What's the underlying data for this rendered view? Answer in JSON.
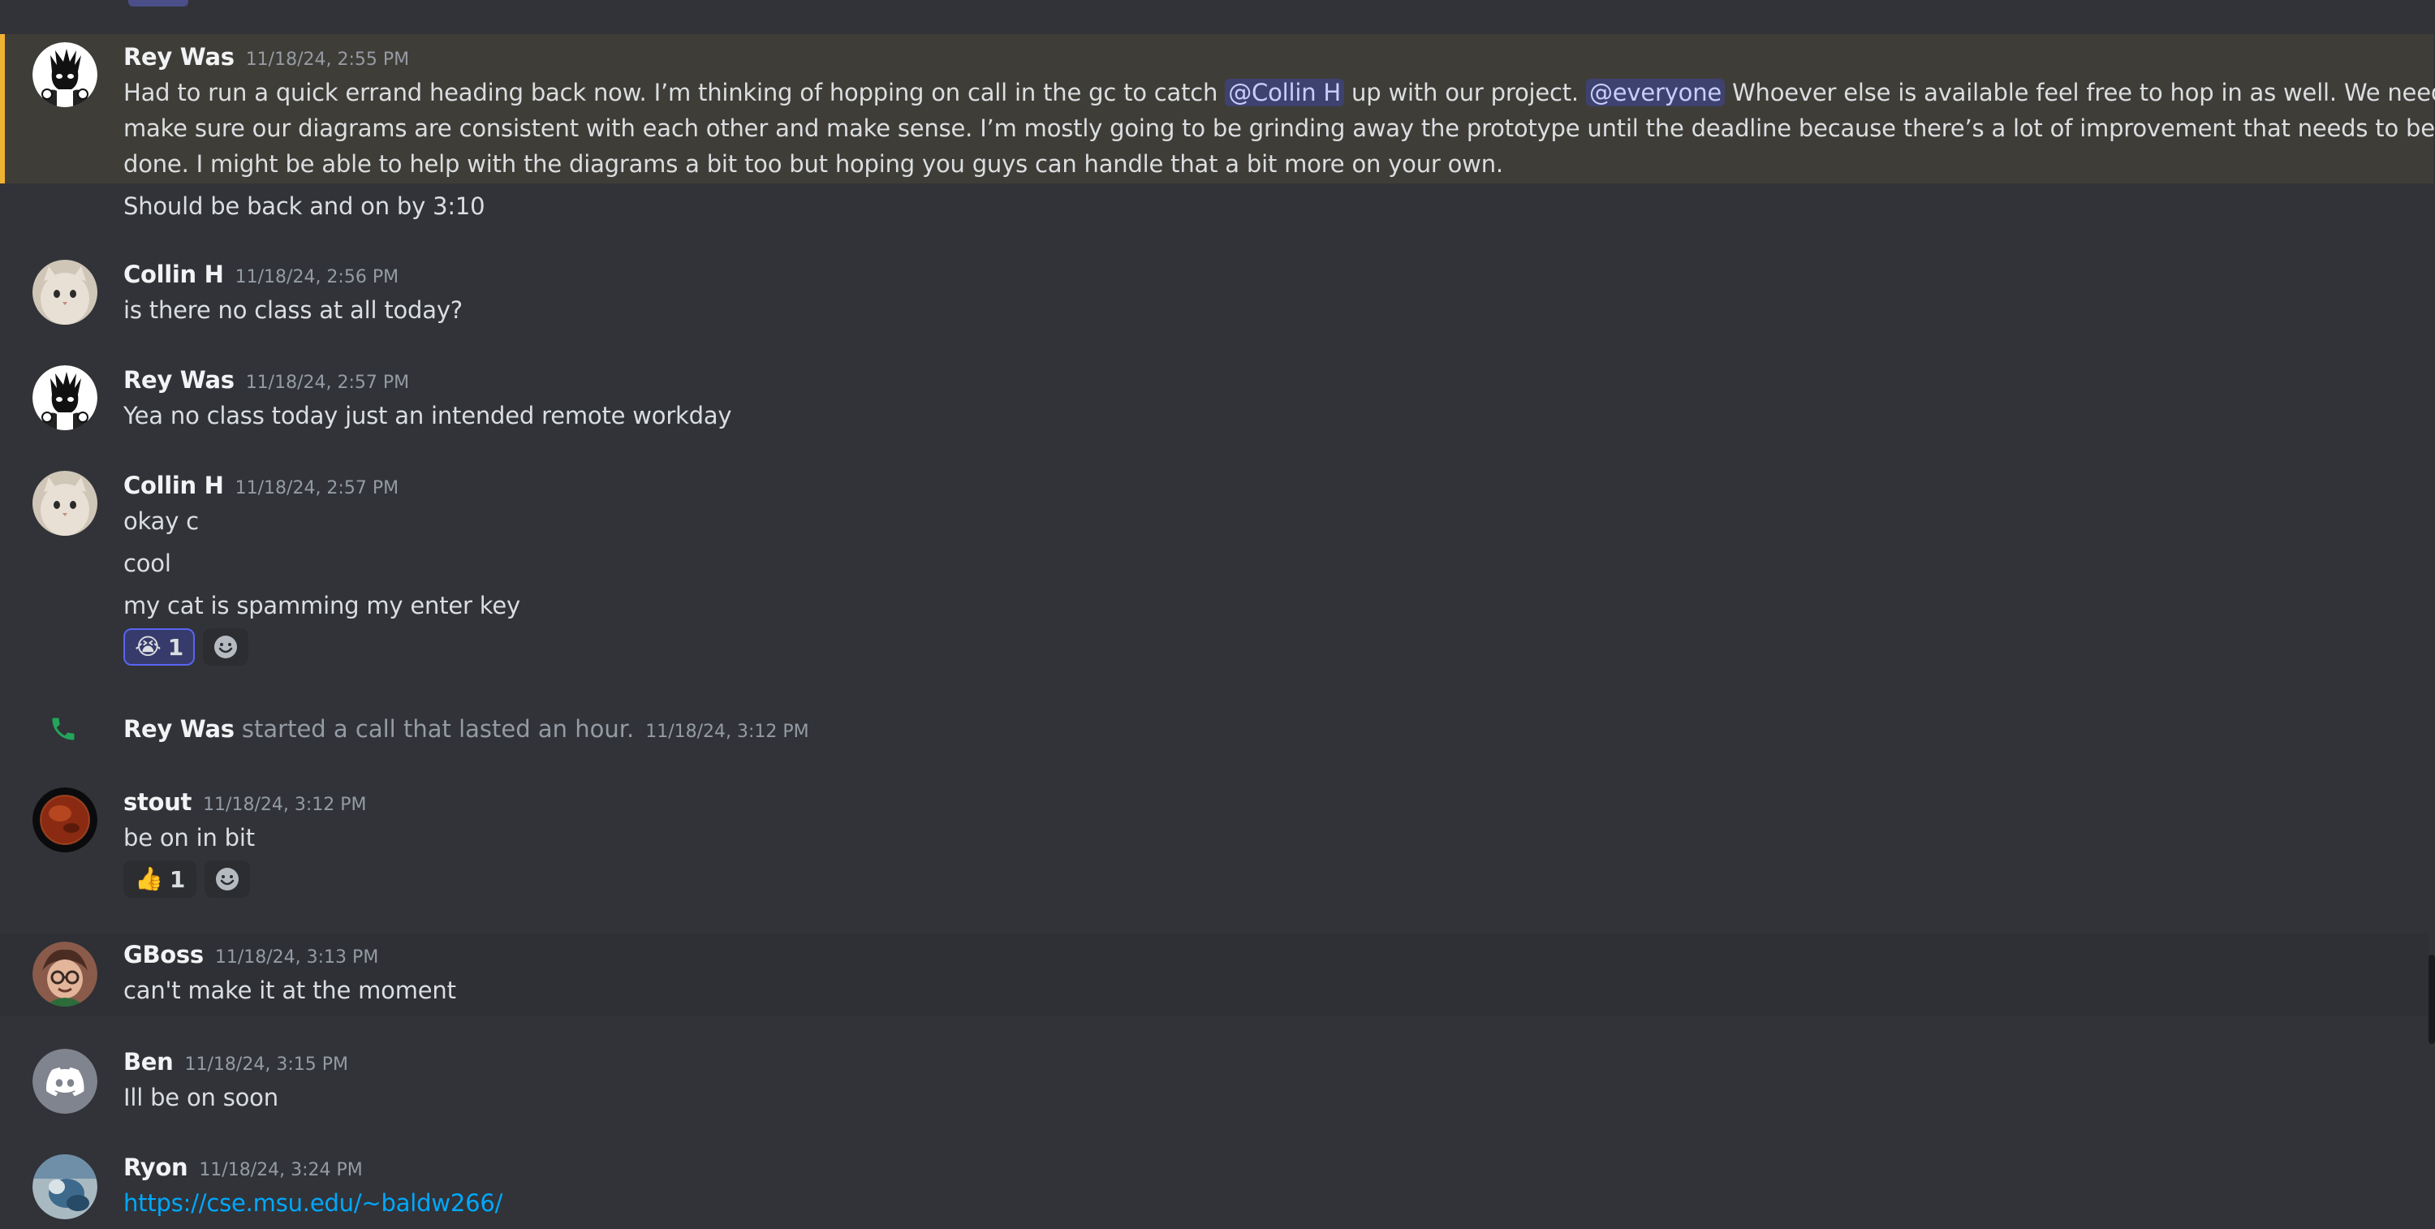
{
  "messages": [
    {
      "author": "Rey Was",
      "timestamp": "11/18/24, 2:55 PM",
      "lines": {
        "l1a": "Had to run a quick errand heading back now. I’m thinking of hopping on call in the gc to catch ",
        "l1_mention": "@Collin H",
        "l1b": " up with our project. ",
        "l1_everyone": "@everyone",
        "l1c": " Whoever else is available feel free to hop in as well. We need to",
        "l2": "make sure our diagrams are consistent with each other and make sense. I’m mostly going to be grinding away the prototype until the deadline because there’s a lot of improvement that needs to be",
        "l3": "done. I might be able to help with the diagrams a bit too but hoping you guys can handle that a bit more on your own.",
        "l4": "Should be back and on by 3:10"
      }
    },
    {
      "author": "Collin H",
      "timestamp": "11/18/24, 2:56 PM",
      "text": "is there no class at all today?"
    },
    {
      "author": "Rey Was",
      "timestamp": "11/18/24, 2:57 PM",
      "text": "Yea no class today just an intended remote workday"
    },
    {
      "author": "Collin H",
      "timestamp": "11/18/24, 2:57 PM",
      "lines": [
        "okay c",
        "cool",
        "my cat is spamming my enter key"
      ],
      "reaction": {
        "emoji": "😭",
        "count": "1"
      }
    },
    {
      "author": "stout",
      "timestamp": "11/18/24, 3:12 PM",
      "text": "be on in bit",
      "reaction": {
        "emoji": "👍",
        "count": "1"
      }
    },
    {
      "author": "GBoss",
      "timestamp": "11/18/24, 3:13 PM",
      "text": "can't make it at the moment"
    },
    {
      "author": "Ben",
      "timestamp": "11/18/24, 3:15 PM",
      "text": "Ill be on soon"
    },
    {
      "author": "Ryon",
      "timestamp": "11/18/24, 3:24 PM",
      "link": "https://cse.msu.edu/~baldw266/"
    }
  ],
  "call": {
    "author": "Rey Was",
    "text": " started a call that lasted an hour.",
    "timestamp": "11/18/24, 3:12 PM",
    "icon": "phone-icon"
  },
  "colors": {
    "background": "#313338",
    "mention_highlight": "#3f3d37",
    "mention_bar": "#f0b232",
    "link": "#00a8fc",
    "call_green": "#23a55a"
  }
}
